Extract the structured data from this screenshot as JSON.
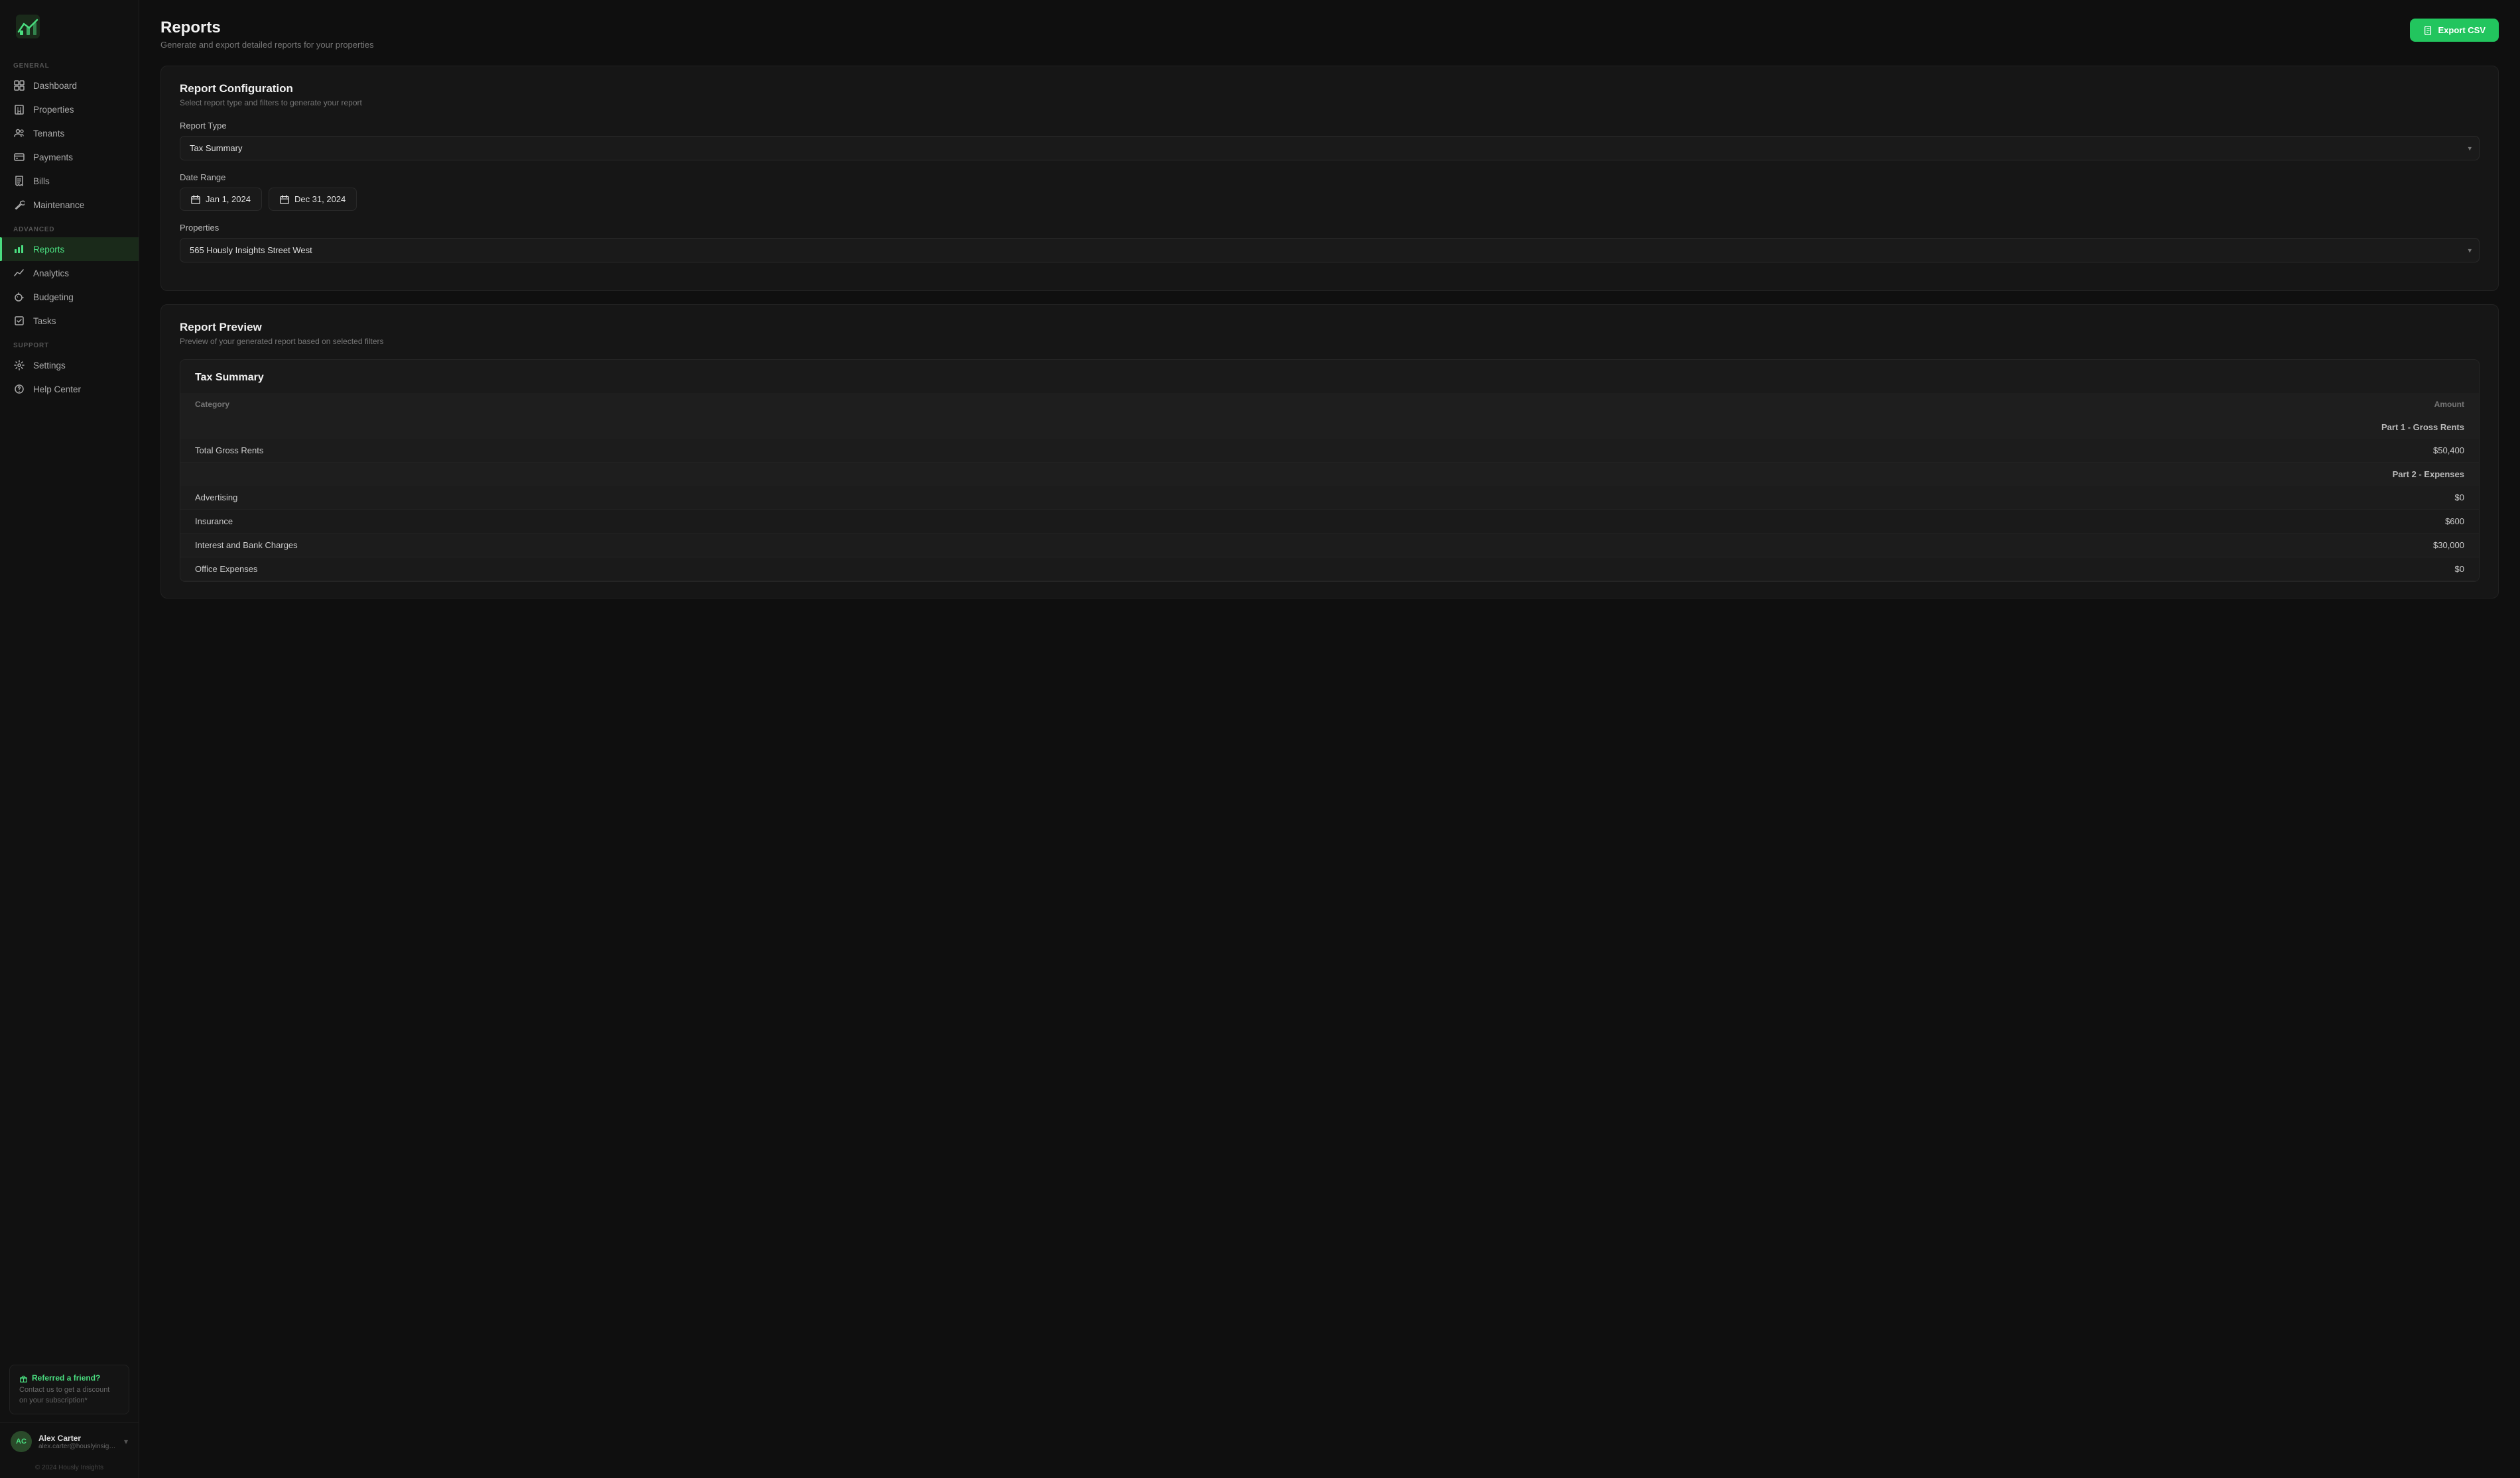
{
  "app": {
    "logo_alt": "Hously Insights Logo"
  },
  "sidebar": {
    "general_label": "GENERAL",
    "advanced_label": "ADVANCED",
    "support_label": "SUPPORT",
    "items_general": [
      {
        "id": "dashboard",
        "label": "Dashboard",
        "icon": "grid"
      },
      {
        "id": "properties",
        "label": "Properties",
        "icon": "building"
      },
      {
        "id": "tenants",
        "label": "Tenants",
        "icon": "users"
      },
      {
        "id": "payments",
        "label": "Payments",
        "icon": "credit-card"
      },
      {
        "id": "bills",
        "label": "Bills",
        "icon": "receipt"
      },
      {
        "id": "maintenance",
        "label": "Maintenance",
        "icon": "wrench"
      }
    ],
    "items_advanced": [
      {
        "id": "reports",
        "label": "Reports",
        "icon": "bar-chart",
        "active": true
      },
      {
        "id": "analytics",
        "label": "Analytics",
        "icon": "line-chart"
      },
      {
        "id": "budgeting",
        "label": "Budgeting",
        "icon": "piggy"
      },
      {
        "id": "tasks",
        "label": "Tasks",
        "icon": "check-square"
      }
    ],
    "items_support": [
      {
        "id": "settings",
        "label": "Settings",
        "icon": "gear"
      },
      {
        "id": "help",
        "label": "Help Center",
        "icon": "question"
      }
    ],
    "referral": {
      "icon": "gift",
      "title": "Referred a friend?",
      "description": "Contact us to get a discount on your subscription*"
    },
    "user": {
      "initials": "AC",
      "name": "Alex Carter",
      "email": "alex.carter@houslyinsights.ca"
    },
    "footer": "© 2024 Hously Insights"
  },
  "page": {
    "title": "Reports",
    "subtitle": "Generate and export detailed reports for your properties",
    "export_btn_label": "Export CSV"
  },
  "report_config": {
    "title": "Report Configuration",
    "subtitle": "Select report type and filters to generate your report",
    "report_type_label": "Report Type",
    "report_type_value": "Tax Summary",
    "date_range_label": "Date Range",
    "date_start": "Jan 1, 2024",
    "date_end": "Dec 31, 2024",
    "properties_label": "Properties",
    "properties_value": "565 Hously Insights Street West"
  },
  "report_preview": {
    "title": "Report Preview",
    "subtitle": "Preview of your generated report based on selected filters",
    "inner_title": "Tax Summary",
    "table": {
      "col_category": "Category",
      "col_amount": "Amount",
      "sections": [
        {
          "section_label": "Part 1 - Gross Rents",
          "rows": [
            {
              "category": "Total Gross Rents",
              "amount": "$50,400"
            }
          ]
        },
        {
          "section_label": "Part 2 - Expenses",
          "rows": [
            {
              "category": "Advertising",
              "amount": "$0"
            },
            {
              "category": "Insurance",
              "amount": "$600"
            },
            {
              "category": "Interest and Bank Charges",
              "amount": "$30,000"
            },
            {
              "category": "Office Expenses",
              "amount": "$0"
            }
          ]
        }
      ]
    }
  }
}
